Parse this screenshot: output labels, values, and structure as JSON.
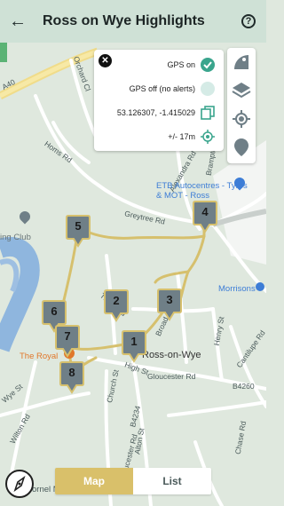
{
  "appbar": {
    "title": "Ross on Wye Highlights",
    "back_icon": "arrow-left-icon",
    "help_icon": "help-circle-icon",
    "help_glyph": "?"
  },
  "gps_panel": {
    "gps_on_label": "GPS on",
    "gps_off_label": "GPS off (no alerts)",
    "coordinates": "53.126307, -1.415029",
    "accuracy": "+/- 17m",
    "gps_on_selected": true
  },
  "map": {
    "road_labels": [
      "A40",
      "Orchard Cl",
      "Homs Rd",
      "Greytree Rd",
      "Alexandra Rd",
      "Brampton Rd",
      "Bridge St",
      "Wye St",
      "Wilton Rd",
      "Church St",
      "High St",
      "Gloucester Rd",
      "Henry St",
      "Cantilupe Rd",
      "Chase Rd",
      "B4234",
      "B4260",
      "Alton St",
      "Old Gloucester Rd",
      "Tudor Rd",
      "Broad St"
    ],
    "place_labels": {
      "club": "ing Club",
      "etb": "ETB Autocentres - Tyres & MOT - Ross",
      "morrisons": "Morrisons",
      "the_royal": "The Royal",
      "town": "Ross-on-Wye",
      "cinema_partial": "ornel Nat"
    },
    "markers": [
      "1",
      "2",
      "3",
      "4",
      "5",
      "6",
      "7",
      "8"
    ]
  },
  "tabs": {
    "map_label": "Map",
    "list_label": "List",
    "active": "Map"
  },
  "colors": {
    "appbar": "#cfe1d6",
    "marker": "#6f7f87",
    "route": "#d6c06d",
    "river": "#8fb6de",
    "accent_green": "#3aa58d",
    "tab_active": "#d9c06a"
  }
}
